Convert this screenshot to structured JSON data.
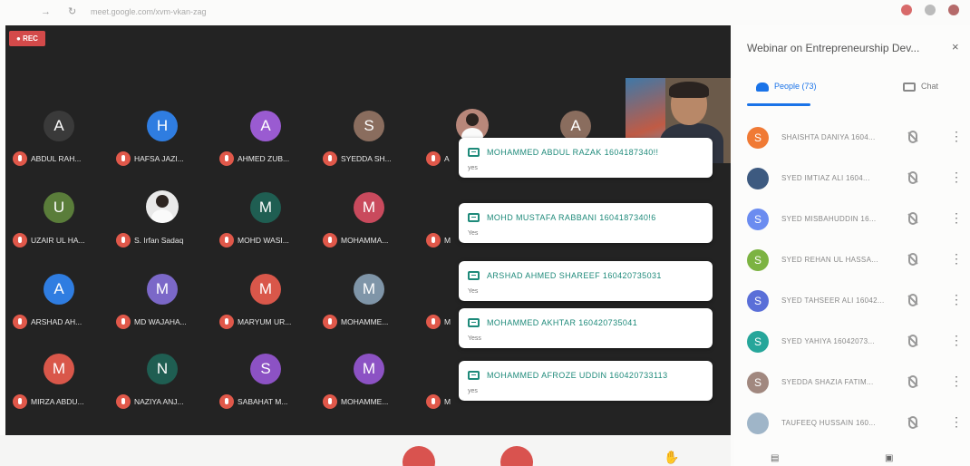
{
  "browser": {
    "url": "meet.google.com/xvm-vkan-zag"
  },
  "stage": {
    "rec_label": "REC",
    "tiles": [
      {
        "initial": "A",
        "name": "ABDUL RAH...",
        "color": "#3a3a3a",
        "kind": "letter"
      },
      {
        "initial": "H",
        "name": "HAFSA JAZI...",
        "color": "#2f7de1",
        "kind": "letter"
      },
      {
        "initial": "A",
        "name": "AHMED ZUB...",
        "color": "#9a5bd1",
        "kind": "letter"
      },
      {
        "initial": "S",
        "name": "SYEDDA SH...",
        "color": "#8a6d5e",
        "kind": "letter"
      },
      {
        "initial": "",
        "name": "A",
        "color": "#b8877a",
        "kind": "photo"
      },
      {
        "initial": "A",
        "name": "",
        "color": "#8a6d5e",
        "kind": "letter"
      },
      {
        "initial": "U",
        "name": "UZAIR UL HA...",
        "color": "#5a7d3a",
        "kind": "letter"
      },
      {
        "initial": "",
        "name": "S. Irfan Sadaq",
        "color": "#e9e9e9",
        "kind": "photo"
      },
      {
        "initial": "M",
        "name": "MOHD WASI...",
        "color": "#1f5e52",
        "kind": "letter"
      },
      {
        "initial": "M",
        "name": "MOHAMMA...",
        "color": "#c94a5d",
        "kind": "letter"
      },
      {
        "initial": "A",
        "name": "ARSHAD AH...",
        "color": "#2f7de1",
        "kind": "letter"
      },
      {
        "initial": "M",
        "name": "MD WAJAHA...",
        "color": "#7b68c8",
        "kind": "letter"
      },
      {
        "initial": "M",
        "name": "MARYUM UR...",
        "color": "#d9574a",
        "kind": "letter"
      },
      {
        "initial": "M",
        "name": "MOHAMME...",
        "color": "#7f95a8",
        "kind": "letter"
      },
      {
        "initial": "M",
        "name": "MIRZA ABDU...",
        "color": "#d9574a",
        "kind": "letter"
      },
      {
        "initial": "N",
        "name": "NAZIYA ANJ...",
        "color": "#1f5e52",
        "kind": "letter"
      },
      {
        "initial": "S",
        "name": "SABAHAT M...",
        "color": "#8c52c4",
        "kind": "letter"
      },
      {
        "initial": "M",
        "name": "MOHAMME...",
        "color": "#8c52c4",
        "kind": "letter"
      }
    ],
    "partial_names": [
      "M",
      "M",
      "M"
    ],
    "popups": [
      {
        "from": "MOHAMMED ABDUL RAZAK 1604187340!!",
        "message": "yes"
      },
      {
        "from": "MOHD MUSTAFA RABBANI 1604187340!6",
        "message": "Yes"
      },
      {
        "from": "ARSHAD AHMED SHAREEF 160420735031",
        "message": "Yes"
      },
      {
        "from": "MOHAMMED AKHTAR 160420735041",
        "message": "Yess"
      },
      {
        "from": "MOHAMMED AFROZE UDDIN 160420733113",
        "message": "yes"
      }
    ]
  },
  "panel": {
    "title": "Webinar on Entrepreneurship Dev...",
    "close": "×",
    "tabs": {
      "people": "People (73)",
      "chat": "Chat"
    },
    "participants": [
      {
        "initial": "S",
        "name": "SHAISHTA DANIYA 1604...",
        "color": "#f07a35"
      },
      {
        "initial": "",
        "name": "SYED IMTIAZ ALI 1604...",
        "color": "#3d5a80"
      },
      {
        "initial": "S",
        "name": "SYED MISBAHUDDIN 16...",
        "color": "#6b8cf0"
      },
      {
        "initial": "S",
        "name": "SYED REHAN UL HASSA...",
        "color": "#7cb342"
      },
      {
        "initial": "S",
        "name": "SYED TAHSEER ALI 16042...",
        "color": "#5a6fd8"
      },
      {
        "initial": "S",
        "name": "SYED YAHIYA 16042073...",
        "color": "#26a69a"
      },
      {
        "initial": "S",
        "name": "SYEDDA SHAZIA FATIM...",
        "color": "#a1887f"
      },
      {
        "initial": "",
        "name": "TAUFEEQ HUSSAIN 160...",
        "color": "#9fb5c8"
      }
    ],
    "more": "⋮"
  }
}
